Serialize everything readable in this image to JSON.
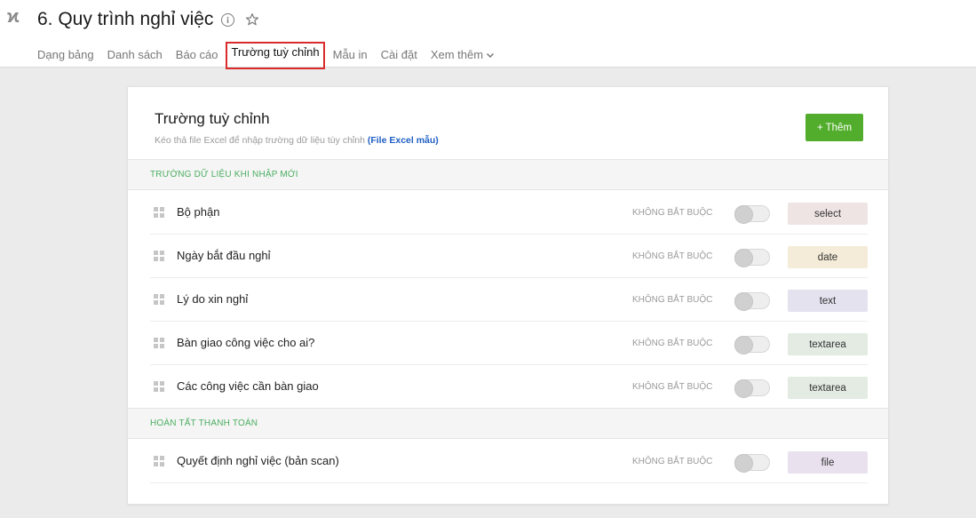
{
  "header": {
    "logo_glyph": "ϰ",
    "title": "6. Quy trình nghỉ việc",
    "info_icon": "info-icon",
    "star_icon": "star-icon"
  },
  "tabs": [
    {
      "label": "Dạng bảng"
    },
    {
      "label": "Danh sách"
    },
    {
      "label": "Báo cáo"
    },
    {
      "label": "Trường tuỳ chỉnh",
      "active": true
    },
    {
      "label": "Mẫu in"
    },
    {
      "label": "Cài đặt"
    },
    {
      "label": "Xem thêm"
    }
  ],
  "card": {
    "title": "Trường tuỳ chỉnh",
    "subtitle": "Kéo thả file Excel để nhập trường dữ liệu tùy chỉnh",
    "subtitle_link": "(File Excel mẫu)",
    "add_button": "+ Thêm"
  },
  "sections": [
    {
      "title": "TRƯỜNG DỮ LIỆU KHI NHẬP MỚI",
      "rows": [
        {
          "name": "Bộ phận",
          "required": "KHÔNG BẮT BUỘC",
          "type": "select",
          "color": "#efe4e4"
        },
        {
          "name": "Ngày bắt đầu nghỉ",
          "required": "KHÔNG BẮT BUỘC",
          "type": "date",
          "color": "#f4ecd8"
        },
        {
          "name": "Lý do xin nghỉ",
          "required": "KHÔNG BẮT BUỘC",
          "type": "text",
          "color": "#e4e2ef"
        },
        {
          "name": "Bàn giao công việc cho ai?",
          "required": "KHÔNG BẮT BUỘC",
          "type": "textarea",
          "color": "#e3ebe3"
        },
        {
          "name": "Các công việc cần bàn giao",
          "required": "KHÔNG BẮT BUỘC",
          "type": "textarea",
          "color": "#e3ebe3"
        }
      ]
    },
    {
      "title": "HOÀN TẤT THANH TOÁN",
      "rows": [
        {
          "name": "Quyết định nghỉ việc (bản scan)",
          "required": "KHÔNG BẮT BUỘC",
          "type": "file",
          "color": "#e9e1ee"
        }
      ]
    }
  ],
  "colors": {
    "accent_green": "#53ad2c",
    "section_green": "#4cae61",
    "active_tab_border": "#d92b2b"
  }
}
